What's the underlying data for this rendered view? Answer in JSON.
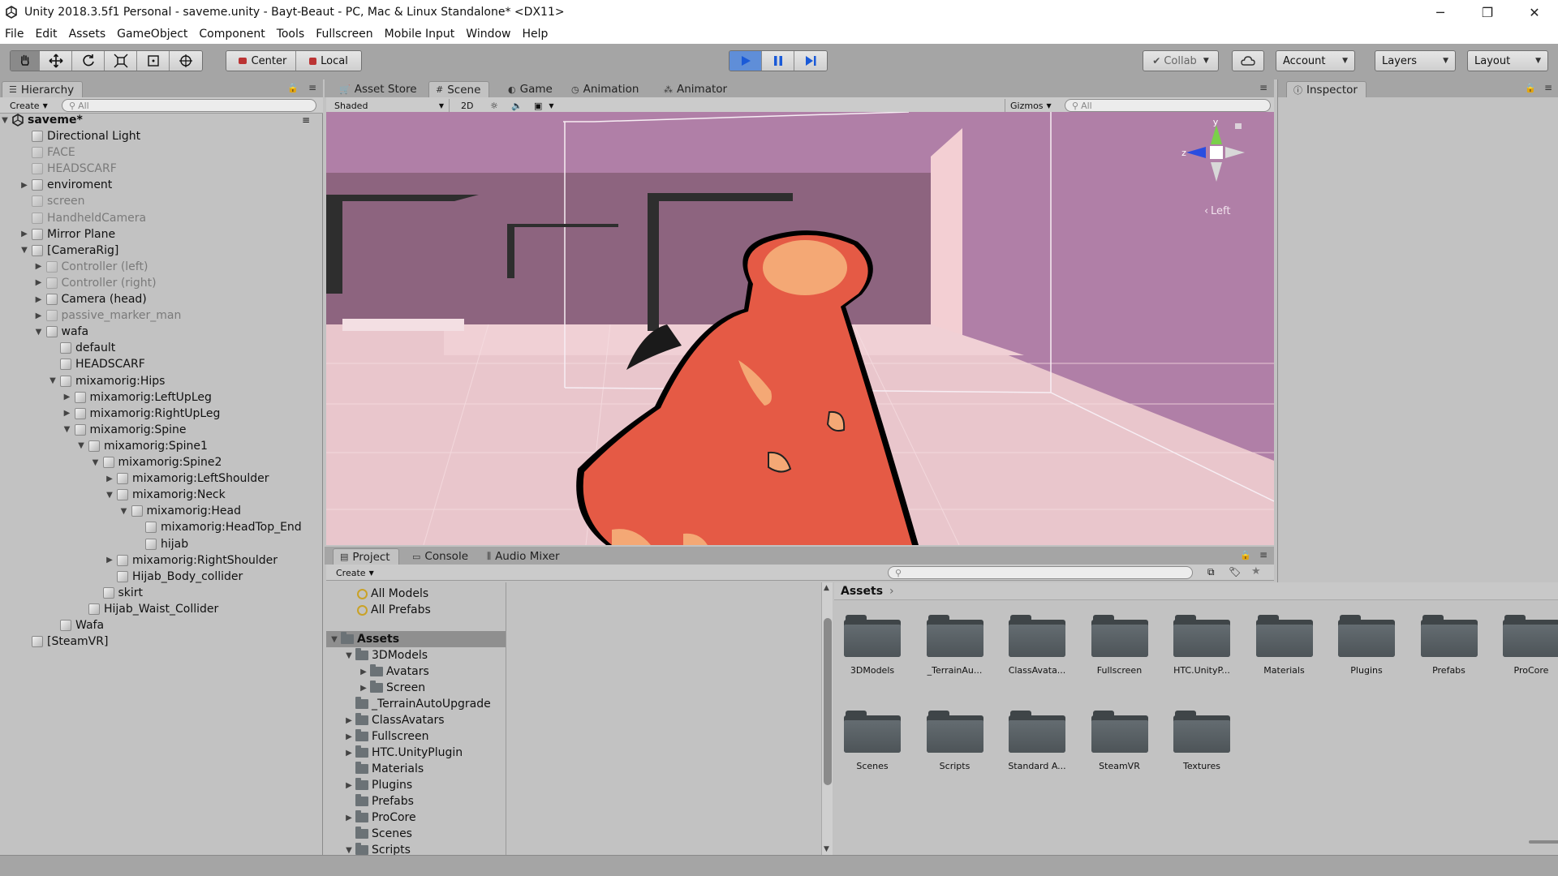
{
  "window": {
    "title": "Unity 2018.3.5f1 Personal - saveme.unity - Bayt-Beaut - PC, Mac & Linux Standalone* <DX11>",
    "minimize_glyph": "─",
    "restore_glyph": "❐",
    "close_glyph": "✕"
  },
  "menu": [
    "File",
    "Edit",
    "Assets",
    "GameObject",
    "Component",
    "Tools",
    "Fullscreen",
    "Mobile Input",
    "Window",
    "Help"
  ],
  "toolbar": {
    "pivot_label": "Center",
    "space_label": "Local",
    "collab_label": "Collab",
    "account_label": "Account",
    "layers_label": "Layers",
    "layout_label": "Layout"
  },
  "hierarchy": {
    "tab_label": "Hierarchy",
    "create_label": "Create",
    "search_placeholder": "All",
    "scene_name": "saveme*",
    "items": [
      {
        "label": "Directional Light",
        "depth": 1,
        "arrow": "",
        "dim": false
      },
      {
        "label": "FACE",
        "depth": 1,
        "arrow": "",
        "dim": true
      },
      {
        "label": "HEADSCARF",
        "depth": 1,
        "arrow": "",
        "dim": true
      },
      {
        "label": "enviroment",
        "depth": 1,
        "arrow": "▶",
        "dim": false
      },
      {
        "label": "screen",
        "depth": 1,
        "arrow": "",
        "dim": true
      },
      {
        "label": "HandheldCamera",
        "depth": 1,
        "arrow": "",
        "dim": true
      },
      {
        "label": "Mirror Plane",
        "depth": 1,
        "arrow": "▶",
        "dim": false
      },
      {
        "label": "[CameraRig]",
        "depth": 1,
        "arrow": "▼",
        "dim": false
      },
      {
        "label": "Controller (left)",
        "depth": 2,
        "arrow": "▶",
        "dim": true
      },
      {
        "label": "Controller (right)",
        "depth": 2,
        "arrow": "▶",
        "dim": true
      },
      {
        "label": "Camera (head)",
        "depth": 2,
        "arrow": "▶",
        "dim": false
      },
      {
        "label": "passive_marker_man",
        "depth": 2,
        "arrow": "▶",
        "dim": true
      },
      {
        "label": "wafa",
        "depth": 2,
        "arrow": "▼",
        "dim": false
      },
      {
        "label": "default",
        "depth": 3,
        "arrow": "",
        "dim": false
      },
      {
        "label": "HEADSCARF",
        "depth": 3,
        "arrow": "",
        "dim": false
      },
      {
        "label": "mixamorig:Hips",
        "depth": 3,
        "arrow": "▼",
        "dim": false
      },
      {
        "label": "mixamorig:LeftUpLeg",
        "depth": 4,
        "arrow": "▶",
        "dim": false
      },
      {
        "label": "mixamorig:RightUpLeg",
        "depth": 4,
        "arrow": "▶",
        "dim": false
      },
      {
        "label": "mixamorig:Spine",
        "depth": 4,
        "arrow": "▼",
        "dim": false
      },
      {
        "label": "mixamorig:Spine1",
        "depth": 5,
        "arrow": "▼",
        "dim": false
      },
      {
        "label": "mixamorig:Spine2",
        "depth": 6,
        "arrow": "▼",
        "dim": false
      },
      {
        "label": "mixamorig:LeftShoulder",
        "depth": 7,
        "arrow": "▶",
        "dim": false
      },
      {
        "label": "mixamorig:Neck",
        "depth": 7,
        "arrow": "▼",
        "dim": false
      },
      {
        "label": "mixamorig:Head",
        "depth": 8,
        "arrow": "▼",
        "dim": false
      },
      {
        "label": "mixamorig:HeadTop_End",
        "depth": 9,
        "arrow": "",
        "dim": false
      },
      {
        "label": "hijab",
        "depth": 9,
        "arrow": "",
        "dim": false
      },
      {
        "label": "mixamorig:RightShoulder",
        "depth": 7,
        "arrow": "▶",
        "dim": false
      },
      {
        "label": "Hijab_Body_collider",
        "depth": 7,
        "arrow": "",
        "dim": false
      },
      {
        "label": "skirt",
        "depth": 6,
        "arrow": "",
        "dim": false
      },
      {
        "label": "Hijab_Waist_Collider",
        "depth": 5,
        "arrow": "",
        "dim": false
      },
      {
        "label": "Wafa",
        "depth": 3,
        "arrow": "",
        "dim": false
      },
      {
        "label": "[SteamVR]",
        "depth": 1,
        "arrow": "",
        "dim": false
      }
    ]
  },
  "scene": {
    "tabs": [
      {
        "label": "Asset Store",
        "icon": "🛒"
      },
      {
        "label": "Scene",
        "icon": "#"
      },
      {
        "label": "Game",
        "icon": "◐"
      },
      {
        "label": "Animation",
        "icon": "◷"
      },
      {
        "label": "Animator",
        "icon": "⁂"
      }
    ],
    "shading_mode": "Shaded",
    "mode_2d": "2D",
    "gizmos_label": "Gizmos",
    "search_placeholder": "All",
    "orientation_label": "Left",
    "axis_y": "y",
    "axis_z": "z"
  },
  "inspector": {
    "tab_label": "Inspector"
  },
  "project": {
    "tabs": [
      {
        "label": "Project",
        "icon": "▤"
      },
      {
        "label": "Console",
        "icon": "▭"
      },
      {
        "label": "Audio Mixer",
        "icon": "⫼"
      }
    ],
    "create_label": "Create",
    "breadcrumb": "Assets",
    "tree": [
      {
        "label": "All Models",
        "depth": 1,
        "arrow": "",
        "kind": "search"
      },
      {
        "label": "All Prefabs",
        "depth": 1,
        "arrow": "",
        "kind": "search"
      },
      {
        "label": "Assets",
        "depth": 0,
        "arrow": "▼",
        "kind": "folder",
        "selected": true
      },
      {
        "label": "3DModels",
        "depth": 1,
        "arrow": "▼",
        "kind": "folder"
      },
      {
        "label": "Avatars",
        "depth": 2,
        "arrow": "▶",
        "kind": "folder"
      },
      {
        "label": "Screen",
        "depth": 2,
        "arrow": "▶",
        "kind": "folder"
      },
      {
        "label": "_TerrainAutoUpgrade",
        "depth": 1,
        "arrow": "",
        "kind": "folder"
      },
      {
        "label": "ClassAvatars",
        "depth": 1,
        "arrow": "▶",
        "kind": "folder"
      },
      {
        "label": "Fullscreen",
        "depth": 1,
        "arrow": "▶",
        "kind": "folder"
      },
      {
        "label": "HTC.UnityPlugin",
        "depth": 1,
        "arrow": "▶",
        "kind": "folder"
      },
      {
        "label": "Materials",
        "depth": 1,
        "arrow": "",
        "kind": "folder"
      },
      {
        "label": "Plugins",
        "depth": 1,
        "arrow": "▶",
        "kind": "folder"
      },
      {
        "label": "Prefabs",
        "depth": 1,
        "arrow": "",
        "kind": "folder"
      },
      {
        "label": "ProCore",
        "depth": 1,
        "arrow": "▶",
        "kind": "folder"
      },
      {
        "label": "Scenes",
        "depth": 1,
        "arrow": "",
        "kind": "folder"
      },
      {
        "label": "Scripts",
        "depth": 1,
        "arrow": "▼",
        "kind": "folder"
      }
    ],
    "asset_folders": [
      "3DModels",
      "_TerrainAu...",
      "ClassAvata...",
      "Fullscreen",
      "HTC.UnityP...",
      "Materials",
      "Plugins",
      "Prefabs",
      "ProCore",
      "Scenes",
      "Scripts",
      "Standard A...",
      "SteamVR",
      "Textures"
    ]
  },
  "colors": {
    "panel_bg": "#c2c2c2",
    "toolbar_bg": "#a5a5a5",
    "play_active": "#5f8ed8",
    "scene_sky": "#b07fa7",
    "character": "#e55a45"
  }
}
